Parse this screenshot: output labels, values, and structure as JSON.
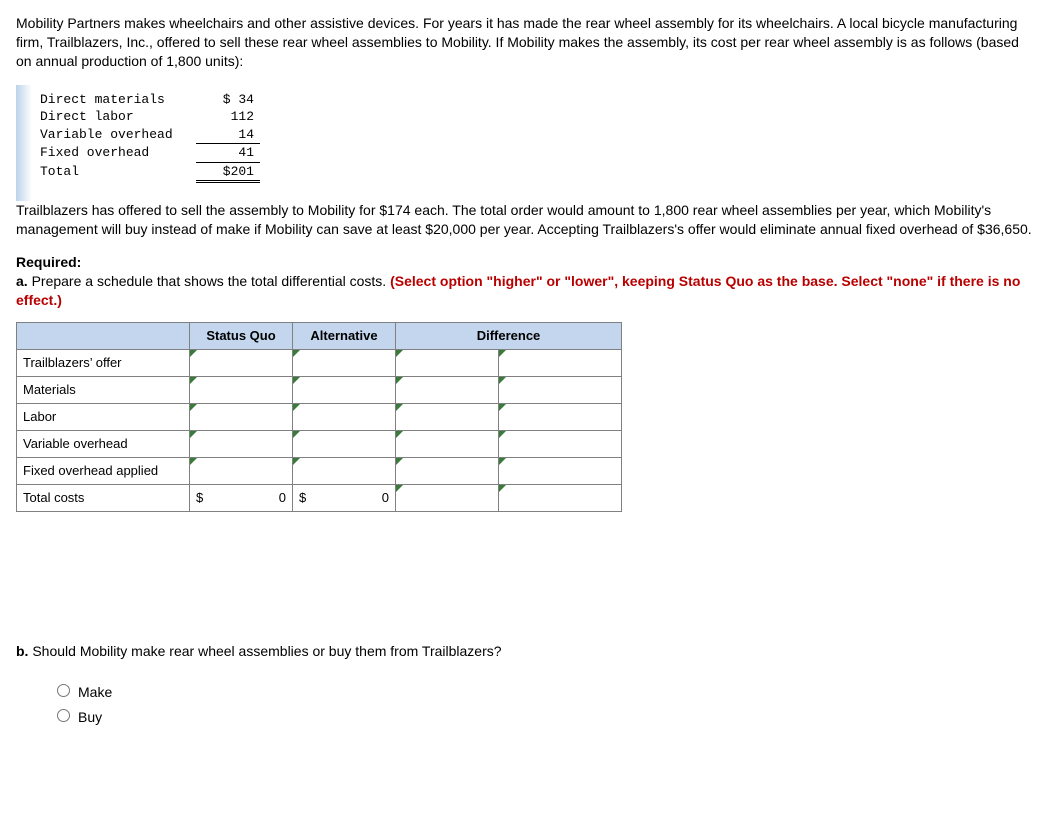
{
  "intro1": "Mobility Partners makes wheelchairs and other assistive devices. For years it has made the rear wheel assembly for its wheelchairs. A local bicycle manufacturing firm, Trailblazers, Inc., offered to sell these rear wheel assemblies to Mobility. If Mobility makes the assembly, its cost per rear wheel assembly is as follows (based on annual production of 1,800 units):",
  "costs": {
    "r1_label": "Direct materials",
    "r1_val": "$ 34",
    "r2_label": "Direct labor",
    "r2_val": "112",
    "r3_label": "Variable overhead",
    "r3_val": "14",
    "r4_label": "Fixed overhead",
    "r4_val": "41",
    "r5_label": "Total",
    "r5_val": "$201"
  },
  "intro2": "Trailblazers has offered to sell the assembly to Mobility for $174 each. The total order would amount to 1,800 rear wheel assemblies per year, which Mobility's management will buy instead of make if Mobility can save at least $20,000 per year. Accepting Trailblazers's offer would eliminate annual fixed overhead of $36,650.",
  "required_label": "Required:",
  "part_a_lead": "a.",
  "part_a_text": " Prepare a schedule that shows the total differential costs. ",
  "part_a_red": "(Select option \"higher\" or \"lower\", keeping Status Quo as the base. Select \"none\" if there is no effect.)",
  "sched": {
    "h1": "Status Quo",
    "h2": "Alternative",
    "h3": "Difference",
    "rows": {
      "r1": "Trailblazers’ offer",
      "r2": "Materials",
      "r3": "Labor",
      "r4": "Variable overhead",
      "r5": "Fixed overhead applied",
      "r6": "Total costs"
    },
    "total_sq": "0",
    "total_alt": "0",
    "dollar": "$"
  },
  "part_b_lead": "b.",
  "part_b_text": " Should Mobility make rear wheel assemblies or buy them from Trailblazers?",
  "options": {
    "make": "Make",
    "buy": "Buy"
  }
}
